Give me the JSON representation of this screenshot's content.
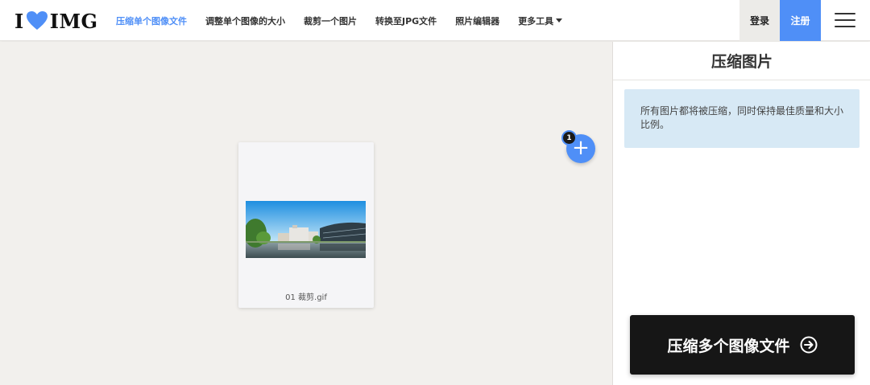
{
  "header": {
    "logo": {
      "left": "I",
      "right": "IMG"
    },
    "nav": [
      {
        "label": "压缩单个图像文件",
        "active": true
      },
      {
        "label": "调整单个图像的大小",
        "active": false
      },
      {
        "label": "裁剪一个图片",
        "active": false
      },
      {
        "label": "转换至JPG文件",
        "active": false
      },
      {
        "label": "照片编辑器",
        "active": false
      },
      {
        "label": "更多工具",
        "active": false,
        "dropdown": true
      }
    ],
    "login_label": "登录",
    "signup_label": "注册"
  },
  "workspace": {
    "file_count": "1",
    "file": {
      "name": "01 裁剪.gif"
    },
    "add_label": "+"
  },
  "sidebar": {
    "title": "压缩图片",
    "info": "所有图片都将被压缩，同时保持最佳质量和大小比例。",
    "action_label": "压缩多个图像文件"
  },
  "colors": {
    "accent": "#4f8ff7",
    "heart": "#4f8ff7",
    "info_bg": "#d7e9f5",
    "action_bg": "#161616"
  },
  "icons": {
    "heart": "heart-icon",
    "menu": "hamburger-menu-icon",
    "caret": "caret-down-icon",
    "add": "plus-icon",
    "arrow": "arrow-right-circle-icon"
  }
}
